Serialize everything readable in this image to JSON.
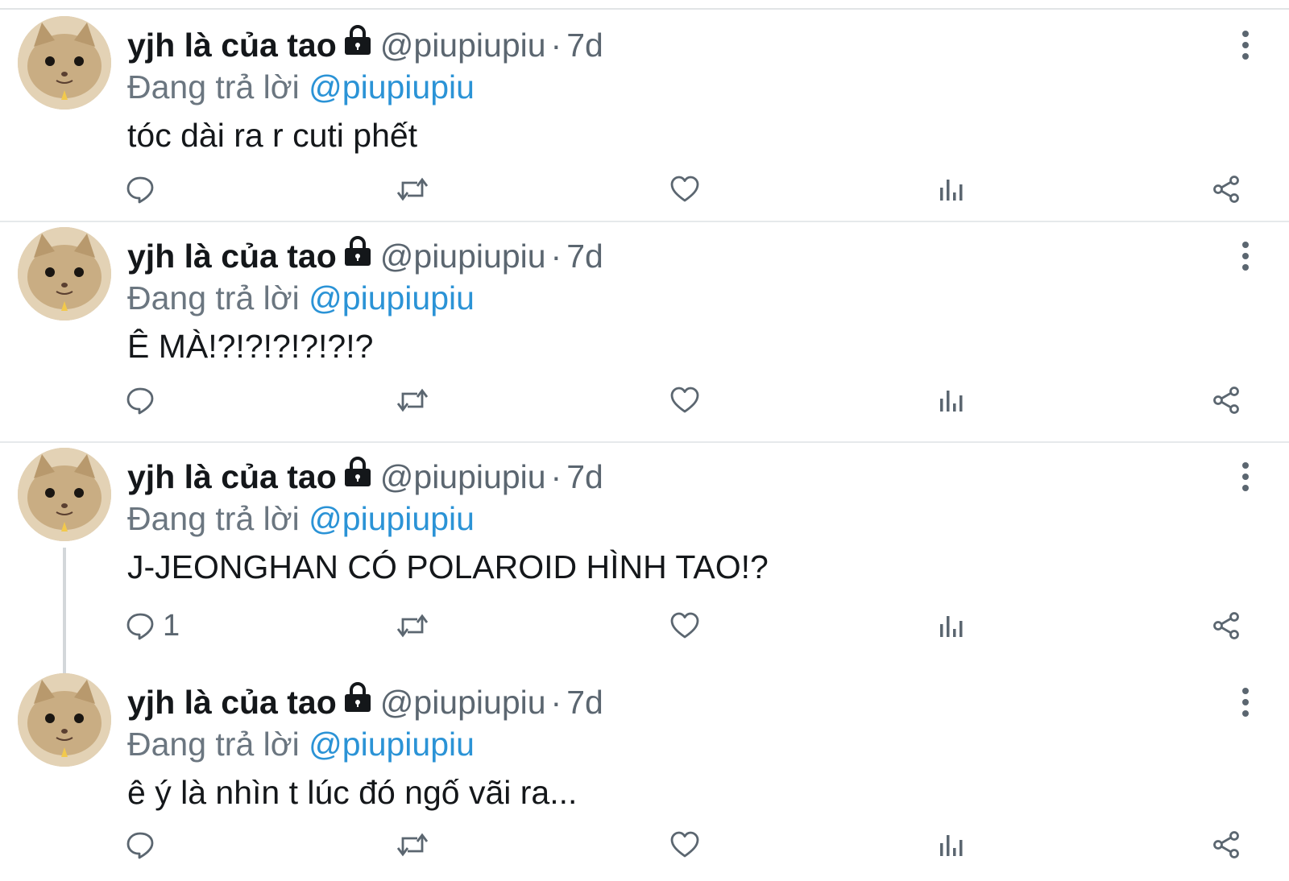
{
  "tweets": [
    {
      "display_name": "yjh là của tao",
      "handle": "@piupiupiu",
      "separator": "·",
      "time": "7d",
      "reply_prefix": "Đang trả lời",
      "reply_mention": "@piupiupiu",
      "text": "tóc dài ra r cuti phết",
      "reply_count": ""
    },
    {
      "display_name": "yjh là của tao",
      "handle": "@piupiupiu",
      "separator": "·",
      "time": "7d",
      "reply_prefix": "Đang trả lời",
      "reply_mention": "@piupiupiu",
      "text": "Ê MÀ!?!?!?!?!?!?",
      "reply_count": ""
    },
    {
      "display_name": "yjh là của tao",
      "handle": "@piupiupiu",
      "separator": "·",
      "time": "7d",
      "reply_prefix": "Đang trả lời",
      "reply_mention": "@piupiupiu",
      "text": "J-JEONGHAN CÓ POLAROID HÌNH TAO!?",
      "reply_count": "1"
    },
    {
      "display_name": "yjh là của tao",
      "handle": "@piupiupiu",
      "separator": "·",
      "time": "7d",
      "reply_prefix": "Đang trả lời",
      "reply_mention": "@piupiupiu",
      "text": "ê ý là nhìn t lúc đó ngố vãi ra...",
      "reply_count": ""
    }
  ],
  "icons": {
    "lock": "lock-icon",
    "more": "more-vertical-icon",
    "reply": "reply-bubble-icon",
    "retweet": "retweet-icon",
    "like": "heart-icon",
    "stats": "analytics-icon",
    "share": "share-icon"
  },
  "colors": {
    "mention": "#2b93d6",
    "secondary_text": "#5b6670",
    "primary_text": "#14171a",
    "divider": "#e6e9eb"
  }
}
